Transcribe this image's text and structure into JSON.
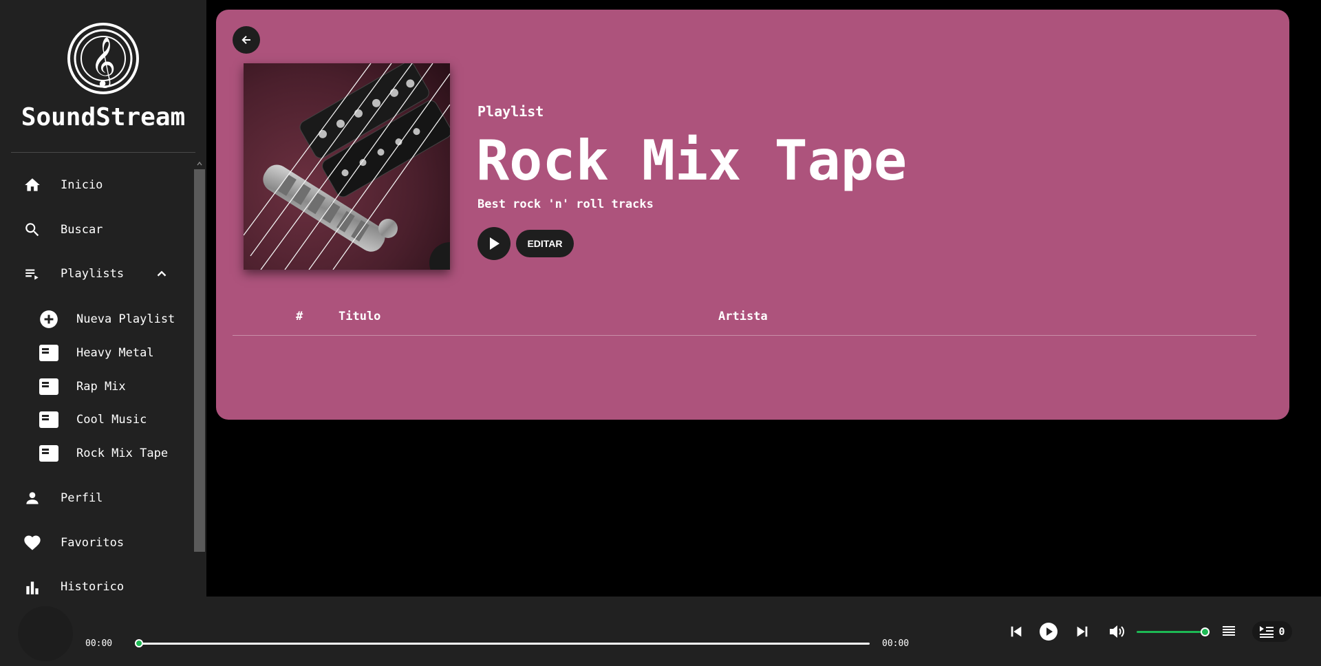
{
  "app": {
    "name": "SoundStream"
  },
  "sidebar": {
    "items": [
      {
        "label": "Inicio",
        "icon": "home-icon"
      },
      {
        "label": "Buscar",
        "icon": "search-icon"
      },
      {
        "label": "Playlists",
        "icon": "playlist-icon"
      },
      {
        "label": "Perfil",
        "icon": "person-icon"
      },
      {
        "label": "Favoritos",
        "icon": "heart-icon"
      },
      {
        "label": "Historico",
        "icon": "bar-chart-icon"
      }
    ],
    "playlists": [
      {
        "label": "Nueva Playlist",
        "icon": "add-circle-icon"
      },
      {
        "label": "Heavy Metal",
        "icon": "playlist-card-icon"
      },
      {
        "label": "Rap Mix",
        "icon": "playlist-card-icon"
      },
      {
        "label": "Cool Music",
        "icon": "playlist-card-icon"
      },
      {
        "label": "Rock Mix Tape",
        "icon": "playlist-card-icon"
      }
    ]
  },
  "playlist": {
    "type_label": "Playlist",
    "title": "Rock Mix Tape",
    "description": "Best rock 'n' roll tracks",
    "edit_label": "EDITAR",
    "cover_alt": "guitar-bridge-pickups",
    "panel_color": "#ad537c"
  },
  "table": {
    "headers": {
      "num": "#",
      "title": "Titulo",
      "artist": "Artista"
    },
    "rows": []
  },
  "player": {
    "current_time": "00:00",
    "total_time": "00:00",
    "progress": 0,
    "volume": 1,
    "queue_count": "0",
    "accent": "#1db954"
  }
}
